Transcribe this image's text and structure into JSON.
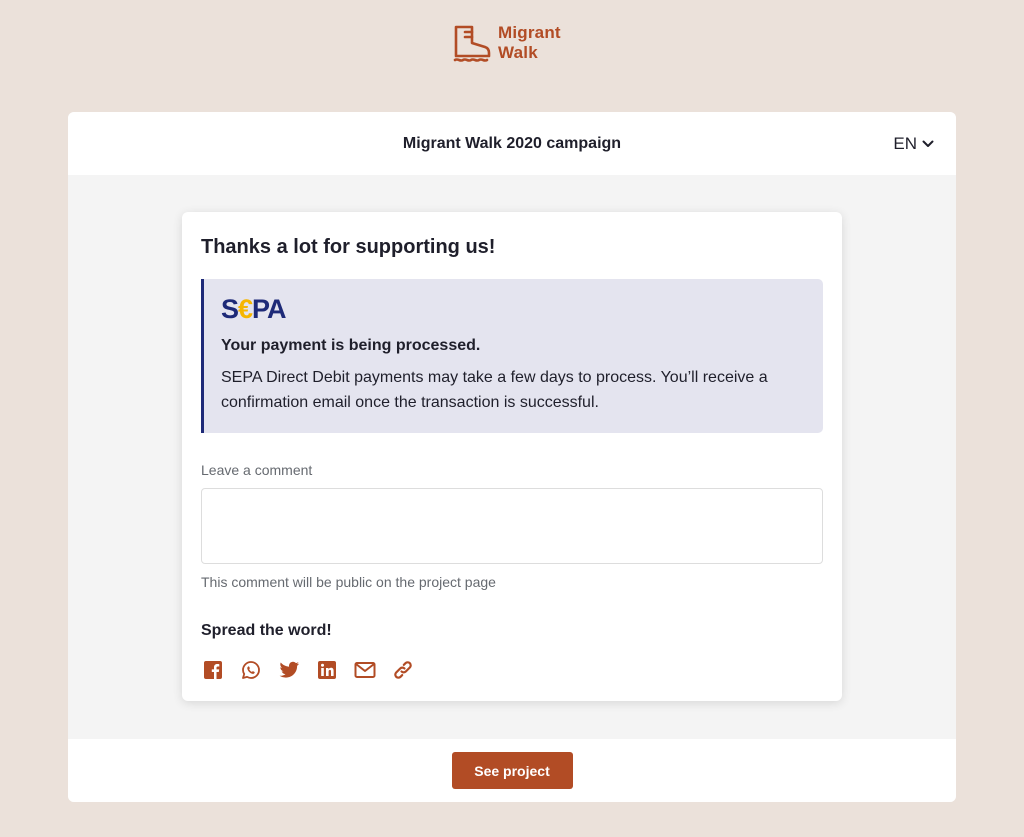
{
  "logo": {
    "line1": "Migrant",
    "line2": "Walk",
    "icon": "boot-icon",
    "color": "#b24c25"
  },
  "header": {
    "title": "Migrant Walk 2020 campaign",
    "language": "EN"
  },
  "confirmation": {
    "title": "Thanks a lot for supporting us!",
    "sepa": {
      "logo_text_s": "S",
      "logo_text_euro": "€",
      "logo_text_pa": "PA",
      "heading": "Your payment is being processed.",
      "body": "SEPA Direct Debit payments may take a few days to process. You’ll receive a confirmation email once the transaction is successful.",
      "accent_color": "#1e2a78",
      "background": "#e4e4ef"
    },
    "comment": {
      "label": "Leave a comment",
      "value": "",
      "placeholder": "",
      "hint": "This comment will be public on the project page"
    },
    "share": {
      "heading": "Spread the word!",
      "icons": [
        "facebook-icon",
        "whatsapp-icon",
        "twitter-icon",
        "linkedin-icon",
        "email-icon",
        "link-icon"
      ],
      "icon_color": "#b24c25"
    }
  },
  "footer": {
    "button_label": "See project",
    "button_color": "#b24c25"
  }
}
